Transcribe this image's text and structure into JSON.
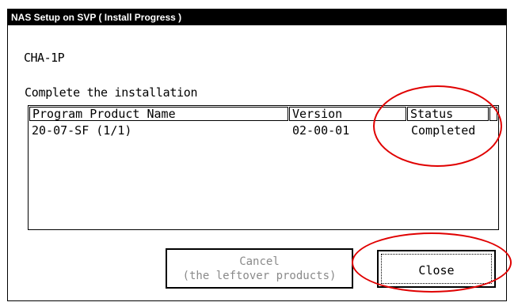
{
  "window": {
    "title": "NAS Setup on SVP ( Install Progress )"
  },
  "channel": "CHA-1P",
  "message": "Complete the installation",
  "table": {
    "columns": [
      "Program Product Name",
      "Version",
      "Status"
    ],
    "rows": [
      {
        "name": "20-07-SF (1/1)",
        "version": "02-00-01",
        "status": "Completed"
      }
    ]
  },
  "buttons": {
    "cancel_line1": "Cancel",
    "cancel_line2": "(the leftover products)",
    "close": "Close"
  },
  "colors": {
    "annotation": "#e00000",
    "titlebar": "#000000",
    "disabled_text": "#8a8a8a"
  }
}
